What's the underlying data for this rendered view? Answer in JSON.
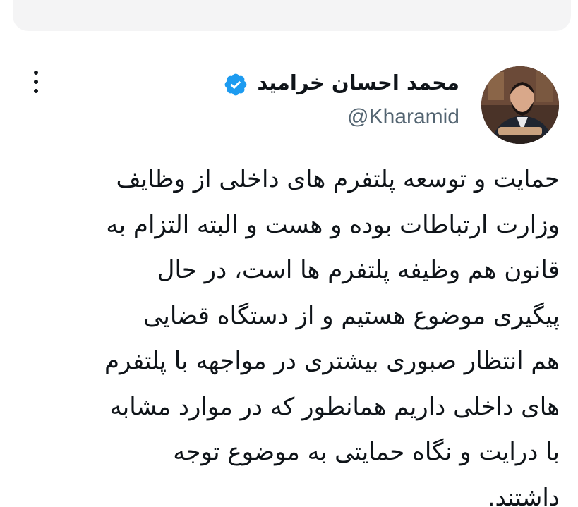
{
  "tweet": {
    "author": {
      "display_name": "محمد احسان خرامید",
      "handle": "@Kharamid",
      "verified": true,
      "avatar_icon": "profile-photo"
    },
    "text_lines": [
      "حمایت و توسعه پلتفرم های داخلی از وظایف",
      "وزارت ارتباطات بوده و هست و البته التزام به",
      "قانون هم وظیفه پلتفرم ها است، در حال",
      "پیگیری موضوع هستیم و از دستگاه قضایی",
      "هم انتظار صبوری بیشتری در مواجهه با پلتفرم",
      "های داخلی داریم همانطور که در موارد مشابه",
      "با درایت و نگاه حمایتی به موضوع توجه",
      "داشتند."
    ],
    "more_icon": "more-vertical-icon"
  },
  "colors": {
    "text": "#0f1419",
    "secondary": "#536471",
    "verified_badge": "#1d9bf0",
    "background": "#ffffff"
  }
}
